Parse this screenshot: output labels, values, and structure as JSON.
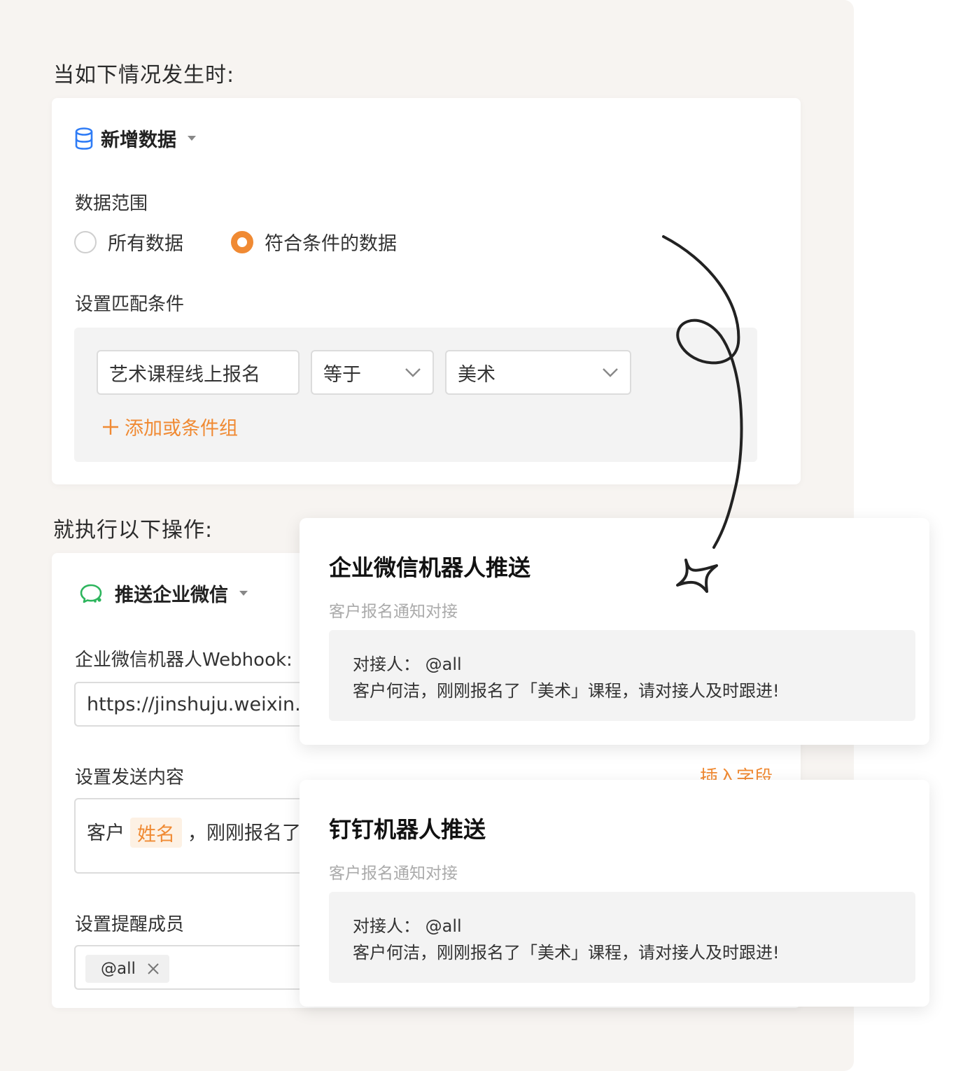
{
  "trigger_section": {
    "heading": "当如下情况发生时:",
    "trigger_label": "新增数据",
    "scope_label": "数据范围",
    "scope_options": [
      {
        "label": "所有数据",
        "checked": false
      },
      {
        "label": "符合条件的数据",
        "checked": true
      }
    ],
    "match_label": "设置匹配条件",
    "condition": {
      "field": "艺术课程线上报名",
      "operator": "等于",
      "value": "美术"
    },
    "add_or_group": "添加或条件组"
  },
  "action_section": {
    "heading": "就执行以下操作:",
    "action_label": "推送企业微信",
    "webhook_label": "企业微信机器人Webhook:",
    "webhook_value": "https://jinshuju.weixin.c",
    "content_label": "设置发送内容",
    "insert_field": "插入字段",
    "content_prefix": "客户",
    "content_tag": "姓名",
    "content_suffix": "，刚刚报名了「",
    "remind_label": "设置提醒成员",
    "member_chip": "@all"
  },
  "popups": [
    {
      "title": "企业微信机器人推送",
      "subtitle": "客户报名通知对接",
      "line1": "对接人： @all",
      "line2": "客户何洁，刚刚报名了「美术」课程，请对接人及时跟进!"
    },
    {
      "title": "钉钉机器人推送",
      "subtitle": "客户报名通知对接",
      "line1": "对接人： @all",
      "line2": "客户何洁，刚刚报名了「美术」课程，请对接人及时跟进!"
    }
  ],
  "colors": {
    "accent": "#f08a33",
    "db_icon": "#2f7cf6",
    "wechat_icon": "#2db55d"
  }
}
